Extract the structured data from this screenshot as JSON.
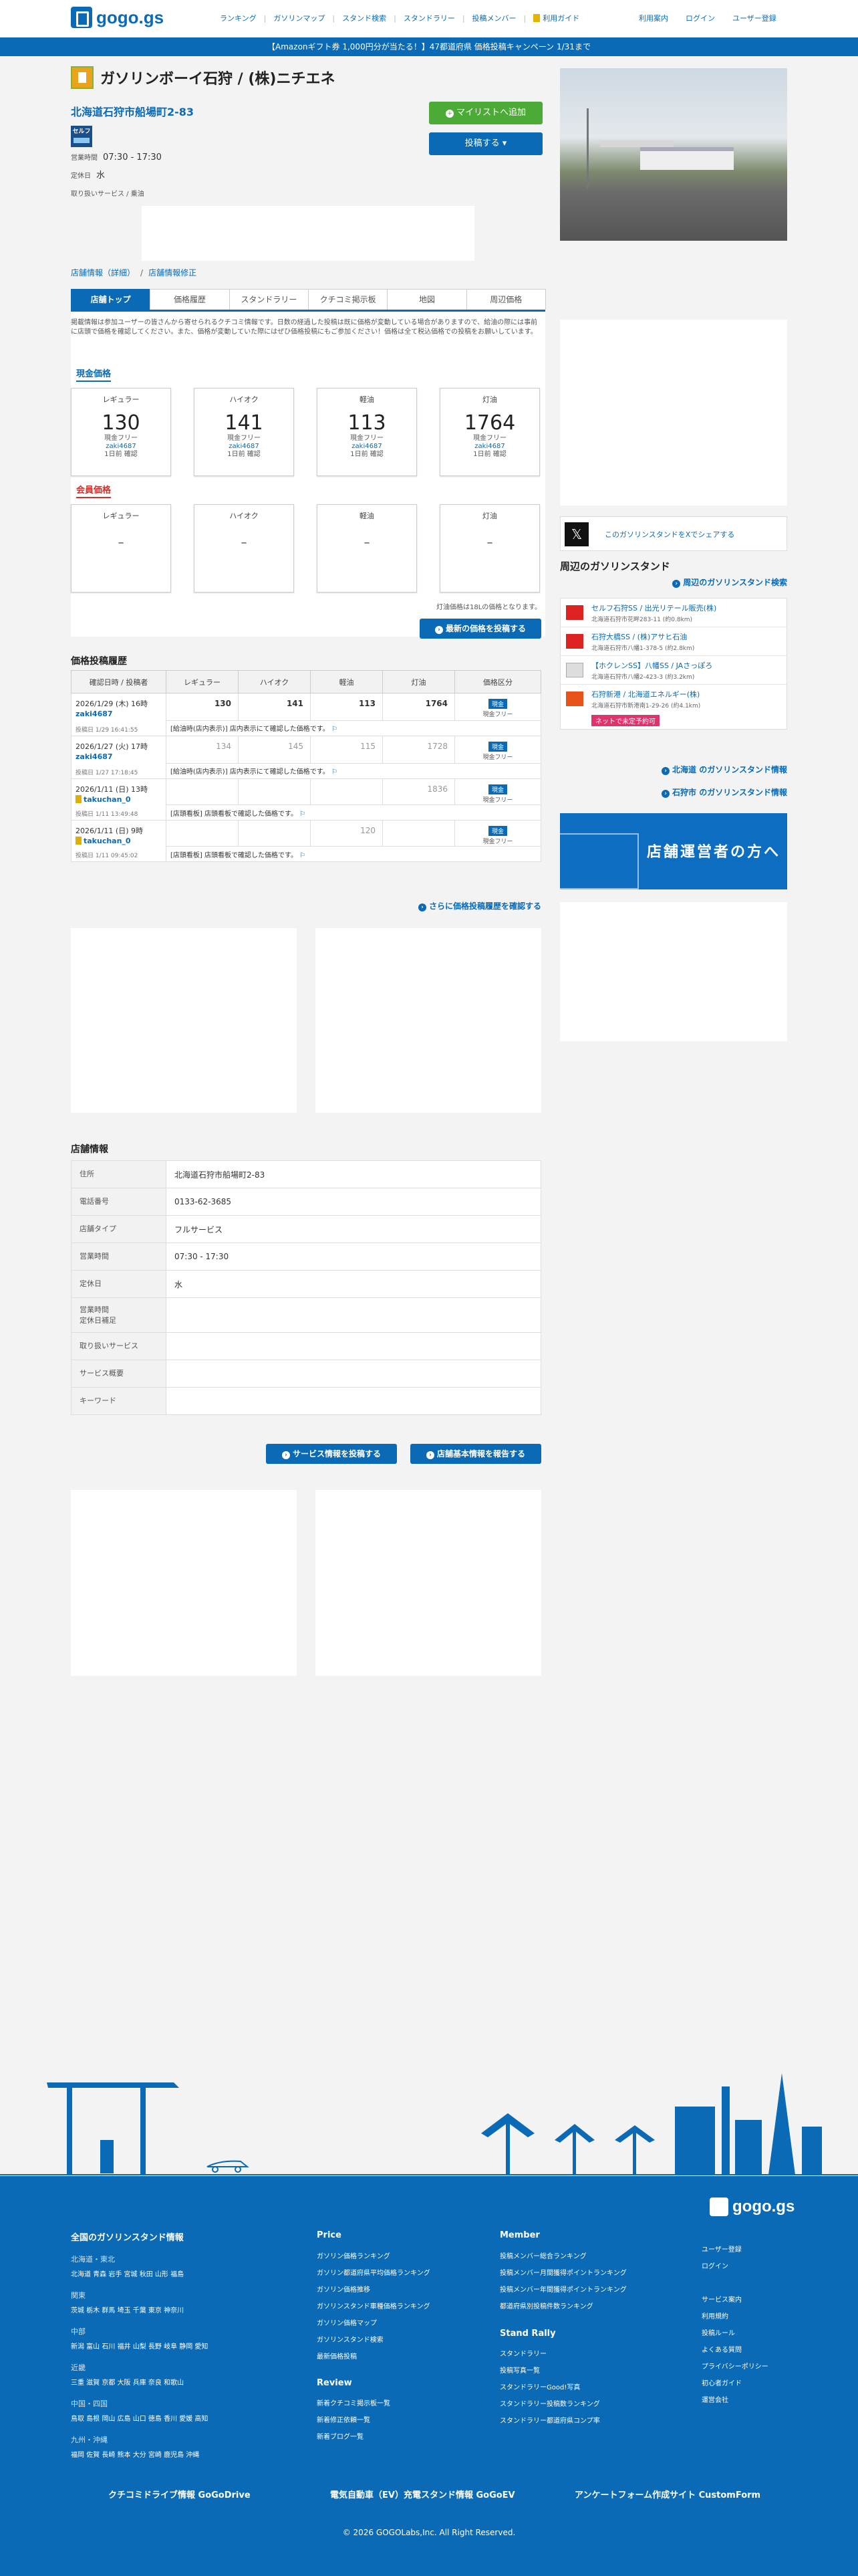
{
  "header": {
    "logo": "gogo.gs",
    "nav": [
      "ランキング",
      "ガソリンマップ",
      "スタンド検索",
      "スタンドラリー",
      "投稿メンバー",
      "利用ガイド"
    ],
    "right_nav": [
      "利用案内",
      "ログイン",
      "ユーザー登録"
    ]
  },
  "banner": "【Amazonギフト券 1,000円分が当たる！】47都道府県 価格投稿キャンペーン 1/31まで",
  "store": {
    "title": "ガソリンボーイ石狩 / (株)ニチエネ",
    "address": "北海道石狩市船場町2-83",
    "self_badge": "セルフ",
    "hours_label": "営業時間",
    "hours": "07:30 - 17:30",
    "holiday_label": "定休日",
    "holiday": "水",
    "services_label": "取り扱いサービス / 乗油",
    "mylist_button": "マイリストへ追加",
    "post_button": "投稿する"
  },
  "breadcrumb": [
    "店舗情報（詳細）",
    "店舗情報修正"
  ],
  "tabs": [
    "店舗トップ",
    "価格履歴",
    "スタンドラリー",
    "クチコミ掲示板",
    "地図",
    "周辺価格"
  ],
  "notice": "掲載情報は参加ユーザーの皆さんから寄せられるクチコミ情報です。日数の経過した投稿は既に価格が変動している場合がありますので、給油の際には事前に店頭で価格を確認してください。また、価格が変動していた際にはぜひ価格投稿にもご参加ください！価格は全て税込価格での投稿をお願いしています。",
  "cash": {
    "heading": "現金価格",
    "cards": [
      {
        "fuel": "レギュラー",
        "price": "130",
        "member": "現金フリー",
        "user": "zaki4687",
        "when": "1日前 確認"
      },
      {
        "fuel": "ハイオク",
        "price": "141",
        "member": "現金フリー",
        "user": "zaki4687",
        "when": "1日前 確認"
      },
      {
        "fuel": "軽油",
        "price": "113",
        "member": "現金フリー",
        "user": "zaki4687",
        "when": "1日前 確認"
      },
      {
        "fuel": "灯油",
        "price": "1764",
        "member": "現金フリー",
        "user": "zaki4687",
        "when": "1日前 確認"
      }
    ]
  },
  "member": {
    "heading": "会員価格",
    "cards": [
      {
        "fuel": "レギュラー",
        "price": "–"
      },
      {
        "fuel": "ハイオク",
        "price": "–"
      },
      {
        "fuel": "軽油",
        "price": "–"
      },
      {
        "fuel": "灯油",
        "price": "–"
      }
    ]
  },
  "kerosene_note": "灯油価格は18Lの価格となります。",
  "post_latest_button": "最新の価格を投稿する",
  "history": {
    "heading": "価格投稿履歴",
    "columns": [
      "確認日時 / 投稿者",
      "レギュラー",
      "ハイオク",
      "軽油",
      "灯油",
      "価格区分"
    ],
    "rows": [
      {
        "date": "2026/1/29 (木) 16時",
        "user": "zaki4687",
        "posted": "投稿日 1/29 16:41:55",
        "regular": "130",
        "high": "141",
        "diesel": "113",
        "kerosene": "1764",
        "kind_tag": "現金",
        "kind": "現金フリー",
        "note": "[給油時(店内表示)] 店内表示にて確認した価格です。",
        "greyed": false,
        "rank": false
      },
      {
        "date": "2026/1/27 (火) 17時",
        "user": "zaki4687",
        "posted": "投稿日 1/27 17:18:45",
        "regular": "134",
        "high": "145",
        "diesel": "115",
        "kerosene": "1728",
        "kind_tag": "現金",
        "kind": "現金フリー",
        "note": "[給油時(店内表示)] 店内表示にて確認した価格です。",
        "greyed": true,
        "rank": false
      },
      {
        "date": "2026/1/11 (日) 13時",
        "user": "takuchan_0",
        "posted": "投稿日 1/11 13:49:48",
        "regular": "",
        "high": "",
        "diesel": "",
        "kerosene": "1836",
        "kind_tag": "現金",
        "kind": "現金フリー",
        "note": "[店頭看板] 店頭看板で確認した価格です。",
        "greyed": true,
        "rank": true
      },
      {
        "date": "2026/1/11 (日) 9時",
        "user": "takuchan_0",
        "posted": "投稿日 1/11 09:45:02",
        "regular": "",
        "high": "",
        "diesel": "120",
        "kerosene": "",
        "kind_tag": "現金",
        "kind": "現金フリー",
        "note": "[店頭看板] 店頭看板で確認した価格です。",
        "greyed": true,
        "rank": true
      }
    ],
    "more_link": "さらに価格投稿履歴を確認する"
  },
  "info": {
    "heading": "店舗情報",
    "rows": [
      {
        "k": "住所",
        "v": "北海道石狩市船場町2-83"
      },
      {
        "k": "電話番号",
        "v": "0133-62-3685"
      },
      {
        "k": "店舗タイプ",
        "v": "フルサービス"
      },
      {
        "k": "営業時間",
        "v": "07:30 - 17:30"
      },
      {
        "k": "定休日",
        "v": "水"
      },
      {
        "k": "営業時間\n定休日補足",
        "v": ""
      },
      {
        "k": "取り扱いサービス",
        "v": ""
      },
      {
        "k": "サービス概要",
        "v": ""
      },
      {
        "k": "キーワード",
        "v": ""
      }
    ],
    "service_button": "サービス情報を投稿する",
    "report_button": "店舗基本情報を報告する"
  },
  "sidebar": {
    "x_share": "このガソリンスタンドをXでシェアする",
    "nearby_heading": "周辺のガソリンスタンド",
    "nearby_search": "周辺のガソリンスタンド検索",
    "nearby": [
      {
        "name": "セルフ石狩SS / 出光リテール販売(株)",
        "addr": "北海道石狩市花畔283-11 (約0.8km)",
        "tag": ""
      },
      {
        "name": "石狩大橋SS / (株)アサヒ石油",
        "addr": "北海道石狩市八幡1-378-5 (約2.8km)",
        "tag": ""
      },
      {
        "name": "【ホクレンSS】八幡SS / JAさっぽろ",
        "addr": "北海道石狩市八幡2-423-3 (約3.2km)",
        "tag": ""
      },
      {
        "name": "石狩新港 / 北海道エネルギー(株)",
        "addr": "北海道石狩市新港南1-29-26 (約4.1km)",
        "tag": "ネットで未定予約可"
      }
    ],
    "pref_link": "北海道 のガソリンスタンド情報",
    "city_link": "石狩市 のガソリンスタンド情報",
    "owner_banner": "店舗運営者の方へ"
  },
  "footer": {
    "logo": "gogo.gs",
    "regions_heading": "全国のガソリンスタンド情報",
    "regions": [
      {
        "name": "北海道・東北",
        "prefs": "北海道 青森 岩手 宮城 秋田 山形 福島"
      },
      {
        "name": "関東",
        "prefs": "茨城 栃木 群馬 埼玉 千葉 東京 神奈川"
      },
      {
        "name": "中部",
        "prefs": "新潟 富山 石川 福井 山梨 長野 岐阜 静岡 愛知"
      },
      {
        "name": "近畿",
        "prefs": "三重 滋賀 京都 大阪 兵庫 奈良 和歌山"
      },
      {
        "name": "中国・四国",
        "prefs": "鳥取 島根 岡山 広島 山口 徳島 香川 愛媛 高知"
      },
      {
        "name": "九州・沖縄",
        "prefs": "福岡 佐賀 長崎 熊本 大分 宮崎 鹿児島 沖縄"
      }
    ],
    "price_heading": "Price",
    "price_links": [
      "ガソリン価格ランキング",
      "ガソリン都道府県平均価格ランキング",
      "ガソリン価格推移",
      "ガソリンスタンド車種価格ランキング",
      "ガソリン価格マップ",
      "ガソリンスタンド検索",
      "最新価格投稿"
    ],
    "review_heading": "Review",
    "review_links": [
      "新着クチコミ掲示板一覧",
      "新着修正依頼一覧",
      "新着ブログ一覧"
    ],
    "member_heading": "Member",
    "member_links": [
      "投稿メンバー総合ランキング",
      "投稿メンバー月間獲得ポイントランキング",
      "投稿メンバー年間獲得ポイントランキング",
      "都道府県別投稿件数ランキング"
    ],
    "rally_heading": "Stand Rally",
    "rally_links": [
      "スタンドラリー",
      "投稿写真一覧",
      "スタンドラリーGood!写真",
      "スタンドラリー投稿数ランキング",
      "スタンドラリー都道府県コンプ率"
    ],
    "misc_links": [
      "ユーザー登録",
      "ログイン",
      "",
      "サービス案内",
      "利用規約",
      "投稿ルール",
      "よくある質問",
      "プライバシーポリシー",
      "初心者ガイド",
      "運営会社"
    ],
    "bottom_links": [
      "クチコミドライブ情報 GoGoDrive",
      "電気自動車（EV）充電スタンド情報 GoGoEV",
      "アンケートフォーム作成サイト CustomForm"
    ],
    "copyright": "© 2026 GOGOLabs,Inc. All Right Reserved."
  }
}
